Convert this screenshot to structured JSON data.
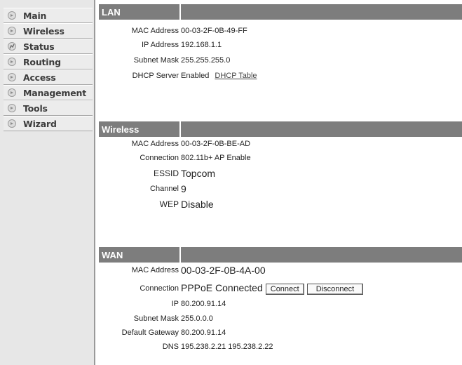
{
  "sidebar": {
    "items": [
      {
        "label": "Main",
        "icon": "bullet-icon"
      },
      {
        "label": "Wireless",
        "icon": "bullet-icon"
      },
      {
        "label": "Status",
        "icon": "status-icon"
      },
      {
        "label": "Routing",
        "icon": "bullet-icon"
      },
      {
        "label": "Access",
        "icon": "bullet-icon"
      },
      {
        "label": "Management",
        "icon": "bullet-icon"
      },
      {
        "label": "Tools",
        "icon": "bullet-icon"
      },
      {
        "label": "Wizard",
        "icon": "bullet-icon"
      }
    ]
  },
  "lan": {
    "title": "LAN",
    "mac_label": "MAC Address",
    "mac_value": "00-03-2F-0B-49-FF",
    "ip_label": "IP Address",
    "ip_value": "192.168.1.1",
    "mask_label": "Subnet Mask",
    "mask_value": "255.255.255.0",
    "dhcp_label": "DHCP Server",
    "dhcp_value": "Enabled",
    "dhcp_link": "DHCP Table"
  },
  "wireless": {
    "title": "Wireless",
    "mac_label": "MAC Address",
    "mac_value": "00-03-2F-0B-BE-AD",
    "conn_label": "Connection",
    "conn_value": "802.11b+ AP Enable",
    "essid_label": "ESSID",
    "essid_value": "Topcom",
    "channel_label": "Channel",
    "channel_value": "9",
    "wep_label": "WEP",
    "wep_value": "Disable"
  },
  "wan": {
    "title": "WAN",
    "mac_label": "MAC Address",
    "mac_value": "00-03-2F-0B-4A-00",
    "conn_label": "Connection",
    "conn_value": "PPPoE Connected",
    "connect_button": "Connect",
    "disconnect_button": "Disconnect",
    "ip_label": "IP",
    "ip_value": "80.200.91.14",
    "mask_label": "Subnet Mask",
    "mask_value": "255.0.0.0",
    "gw_label": "Default Gateway",
    "gw_value": "80.200.91.14",
    "dns_label": "DNS",
    "dns_value": "195.238.2.21 195.238.2.22"
  }
}
